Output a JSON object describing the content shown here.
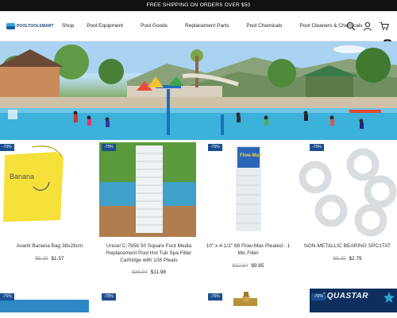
{
  "announcement": "FREE SHIPPING ON ORDERS OVER $50",
  "brand": {
    "name": "POOLTOOLSMART"
  },
  "nav": [
    "Shop",
    "Pool Equipment",
    "Pool Goods",
    "Replacement Parts",
    "Pool Chemicals",
    "Pool Cleaners & Chemicals"
  ],
  "header_icons": [
    "search-icon",
    "account-icon",
    "cart-icon"
  ],
  "cart_count": "0",
  "products": [
    {
      "badge": "-70%",
      "title": "Avanti Banana Bag 38x28cm",
      "old_price": "$5.35",
      "new_price": "$1.57"
    },
    {
      "badge": "-70%",
      "title": "Unicel C-7656 50 Square Foot Media Replacement Pool Hot Tub Spa Filter Cartridge with 108 Pleats",
      "old_price": "$39.94",
      "new_price": "$11.98"
    },
    {
      "badge": "-70%",
      "title": "10\" x 4-1/2\" 88 Flow-Max Pleated - 1 Mic Filter",
      "old_price": "$32.84",
      "new_price": "$9.85"
    },
    {
      "badge": "-70%",
      "title": "NON-METALLIC BEARING SPC1TAT",
      "old_price": "$9.29",
      "new_price": "$2.79"
    }
  ],
  "row2": [
    {
      "badge": "-70%"
    },
    {
      "badge": "-70%"
    },
    {
      "badge": "-70%"
    },
    {
      "badge": "-70%",
      "logo": "AQUASTAR"
    }
  ],
  "colors": {
    "badge": "#1c4e8f",
    "topbar": "#111111"
  }
}
